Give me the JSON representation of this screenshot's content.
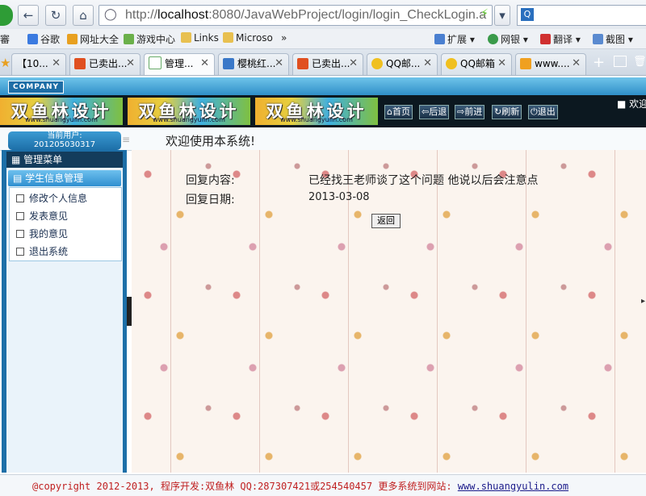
{
  "browser": {
    "address": "http://localhost:8080/JavaWebProject/login/login_CheckLogin.a",
    "address_host": "localhost",
    "bookmarks": [
      "谷歌",
      "网址大全",
      "游戏中心",
      "Links",
      "Microso",
      "»",
      "扩展",
      "网银",
      "翻译",
      "截图"
    ],
    "tabs": [
      "【10...",
      "已卖出...",
      "管理...",
      "樱桃红...",
      "已卖出...",
      "QQ邮...",
      "QQ邮箱",
      "www...."
    ]
  },
  "site": {
    "company": "COMPANY",
    "logo_text": "双鱼林设计",
    "logo_url": "www.shuangyulin.com",
    "nav": [
      "首页",
      "后退",
      "前进",
      "刷新",
      "退出"
    ],
    "top_right": "欢迎"
  },
  "user": {
    "label": "当前用户:",
    "id": "201205030317"
  },
  "welcome": "欢迎使用本系统!",
  "sidebar": {
    "menu_title": "管理菜单",
    "group": "学生信息管理",
    "items": [
      "修改个人信息",
      "发表意见",
      "我的意见",
      "退出系统"
    ]
  },
  "reply": {
    "content_label": "回复内容:",
    "content": "已经找王老师谈了这个问题 他说以后会注意点",
    "date_label": "回复日期:",
    "date": "2013-03-08",
    "back": "返回"
  },
  "footer": {
    "text": "@copyright 2012-2013, 程序开发:双鱼林  QQ:287307421或254540457  更多系统到网站:",
    "link": "www.shuangyulin.com"
  }
}
